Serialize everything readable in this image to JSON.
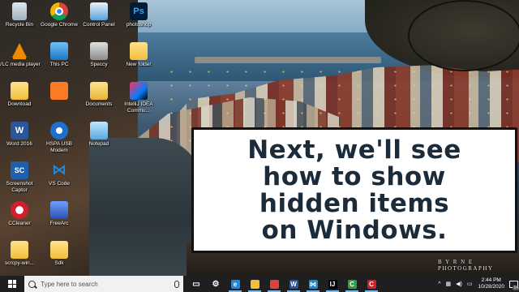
{
  "desktop": {
    "icons": [
      {
        "label": "Recycle Bin",
        "icon": "recycle-bin-icon"
      },
      {
        "label": "Google Chrome",
        "icon": "chrome-icon"
      },
      {
        "label": "Control Panel",
        "icon": "control-panel-icon"
      },
      {
        "label": "photoshop",
        "icon": "photoshop-icon",
        "glyph": "Ps"
      },
      {
        "label": "VLC media player",
        "icon": "vlc-icon"
      },
      {
        "label": "This PC",
        "icon": "this-pc-icon"
      },
      {
        "label": "Speccy",
        "icon": "speccy-icon"
      },
      {
        "label": "New folder",
        "icon": "folder-icon"
      },
      {
        "label": "Download",
        "icon": "downloads-folder-icon"
      },
      {
        "label": "",
        "icon": "xampp-icon"
      },
      {
        "label": "Documents",
        "icon": "documents-folder-icon"
      },
      {
        "label": "IntelliJ IDEA Commu...",
        "icon": "intellij-idea-icon"
      },
      {
        "label": "Word 2016",
        "icon": "word-icon",
        "glyph": "W"
      },
      {
        "label": "HSPA USB Modem",
        "icon": "hspa-modem-icon"
      },
      {
        "label": "Notepad",
        "icon": "notepad-icon"
      },
      {
        "label": "Screenshot Captor",
        "icon": "screenshot-captor-icon",
        "glyph": "SC"
      },
      {
        "label": "VS Code",
        "icon": "vscode-icon",
        "glyph": "⋈"
      },
      {
        "label": "CCleaner",
        "icon": "ccleaner-icon"
      },
      {
        "label": "FreeArc",
        "icon": "freearc-icon"
      },
      {
        "label": "scrcpy-win...",
        "icon": "folder-icon"
      },
      {
        "label": "Sdk",
        "icon": "folder-icon"
      }
    ]
  },
  "banner": {
    "lines": [
      "Next, we'll see",
      "how to show",
      "hidden items",
      "on Windows."
    ]
  },
  "watermark": "B Y R N E   PHOTOGRAPHY",
  "taskbar": {
    "search_placeholder": "Type here to search",
    "pinned": [
      {
        "name": "task-view-icon",
        "glyph": "▭",
        "color": "#1f1f1f"
      },
      {
        "name": "settings-icon",
        "glyph": "⚙",
        "color": "#1f1f1f"
      },
      {
        "name": "edge-icon",
        "glyph": "e",
        "color": "#1e88e5"
      },
      {
        "name": "file-explorer-icon",
        "glyph": "",
        "color": "#f0be3c"
      },
      {
        "name": "chrome-icon",
        "glyph": "",
        "color": "#db4437"
      },
      {
        "name": "word-icon",
        "glyph": "W",
        "color": "#2b579a"
      },
      {
        "name": "vscode-icon",
        "glyph": "⋈",
        "color": "#1e8ad6"
      },
      {
        "name": "intellij-idea-icon",
        "glyph": "IJ",
        "color": "#000000"
      },
      {
        "name": "camtasia-icon",
        "glyph": "C",
        "color": "#2ea043"
      },
      {
        "name": "screen-recorder-icon",
        "glyph": "C",
        "color": "#d1202c"
      }
    ],
    "tray": {
      "clock_time": "2:44 PM",
      "clock_date": "10/28/2020",
      "notification_count": "14"
    }
  }
}
